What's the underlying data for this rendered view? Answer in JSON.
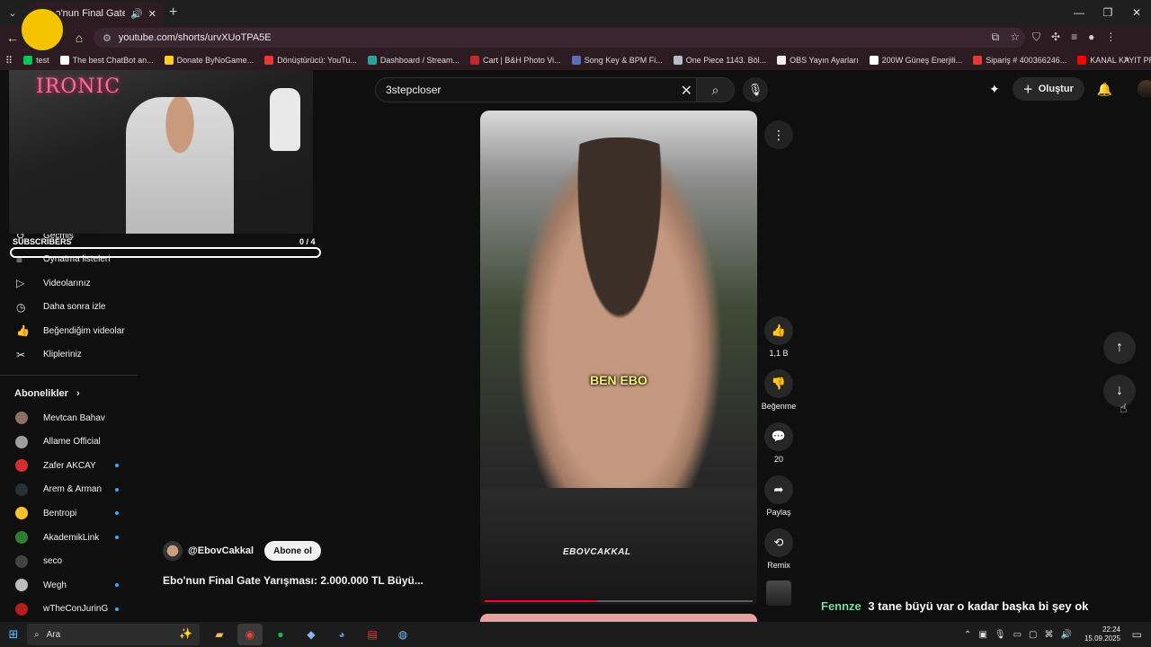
{
  "browser": {
    "tab_title": "Ebo'nun Final Gate Yarışma",
    "url": "youtube.com/shorts/urvXUoTPA5E",
    "bookmarks": [
      {
        "label": "test",
        "color": "#00c853"
      },
      {
        "label": "The best ChatBot an...",
        "color": "#ffffff"
      },
      {
        "label": "Donate ByNoGame...",
        "color": "#ffca28"
      },
      {
        "label": "Dönüştürücü: YouTu...",
        "color": "#e53935"
      },
      {
        "label": "Dashboard / Stream...",
        "color": "#26a69a"
      },
      {
        "label": "Cart | B&H Photo Vi...",
        "color": "#c62828"
      },
      {
        "label": "Song Key & BPM Fi...",
        "color": "#5c6bc0"
      },
      {
        "label": "One Piece 1143. Böl...",
        "color": "#b0bec5"
      },
      {
        "label": "OBS Yayın Ayarları",
        "color": "#eeeeee"
      },
      {
        "label": "200W Güneş Enerjili...",
        "color": "#ffffff"
      },
      {
        "label": "Sipariş # 400366246...",
        "color": "#e53935"
      },
      {
        "label": "KANAL KAYIT PROG...",
        "color": "#ff0000"
      }
    ]
  },
  "youtube": {
    "search_value": "3stepcloser",
    "create_label": "Oluştur",
    "sidebar_items": [
      {
        "label": "Geçmiş",
        "icon": "history-icon",
        "glyph": "↺"
      },
      {
        "label": "Oynatma listeleri",
        "icon": "playlist-icon",
        "glyph": "≡"
      },
      {
        "label": "Videolarınız",
        "icon": "your-videos-icon",
        "glyph": "▷"
      },
      {
        "label": "Daha sonra izle",
        "icon": "watch-later-icon",
        "glyph": "◷"
      },
      {
        "label": "Beğendiğim videolar",
        "icon": "thumbs-up-icon",
        "glyph": "👍"
      },
      {
        "label": "Klipleriniz",
        "icon": "scissors-icon",
        "glyph": "✂"
      }
    ],
    "subscriptions_title": "Abonelikler",
    "subscriptions": [
      {
        "name": "Mevtcan Bahav",
        "color": "#8d6e63",
        "live": false
      },
      {
        "name": "Allame Official",
        "color": "#9e9e9e",
        "live": false
      },
      {
        "name": "Zafer AKCAY",
        "color": "#d32f2f",
        "live": true
      },
      {
        "name": "Arem & Arman",
        "color": "#263238",
        "live": true
      },
      {
        "name": "Bentropi",
        "color": "#fbc02d",
        "live": true
      },
      {
        "name": "AkademikLink",
        "color": "#2e7d32",
        "live": true
      },
      {
        "name": "seco",
        "color": "#424242",
        "live": false
      },
      {
        "name": "Wegh",
        "color": "#bdbdbd",
        "live": true
      },
      {
        "name": "wTheConJurinG",
        "color": "#b71c1c",
        "live": true
      }
    ],
    "short": {
      "caption": "BEN EBO",
      "watermark": "EBOVCAKKAL",
      "channel": "@EbovCakkal",
      "subscribe_label": "Abone ol",
      "title": "Ebo'nun Final Gate Yarışması: 2.000.000 TL Büyü...",
      "likes": "1,1 B",
      "dislike_label": "Beğenme",
      "comments": "20",
      "share_label": "Paylaş",
      "remix_label": "Remix",
      "progress": 0.42
    }
  },
  "stream_overlay": {
    "sign_text": "IRONIC",
    "subscribers_label": "SUBSCRIBERS",
    "subscribers_count": "0 / 4",
    "chat_user": "Fennze",
    "chat_message": "3 tane büyü var o kadar başka bi şey ok"
  },
  "taskbar": {
    "search_label": "Ara",
    "time": "22:24",
    "date": "15.09.2025"
  }
}
